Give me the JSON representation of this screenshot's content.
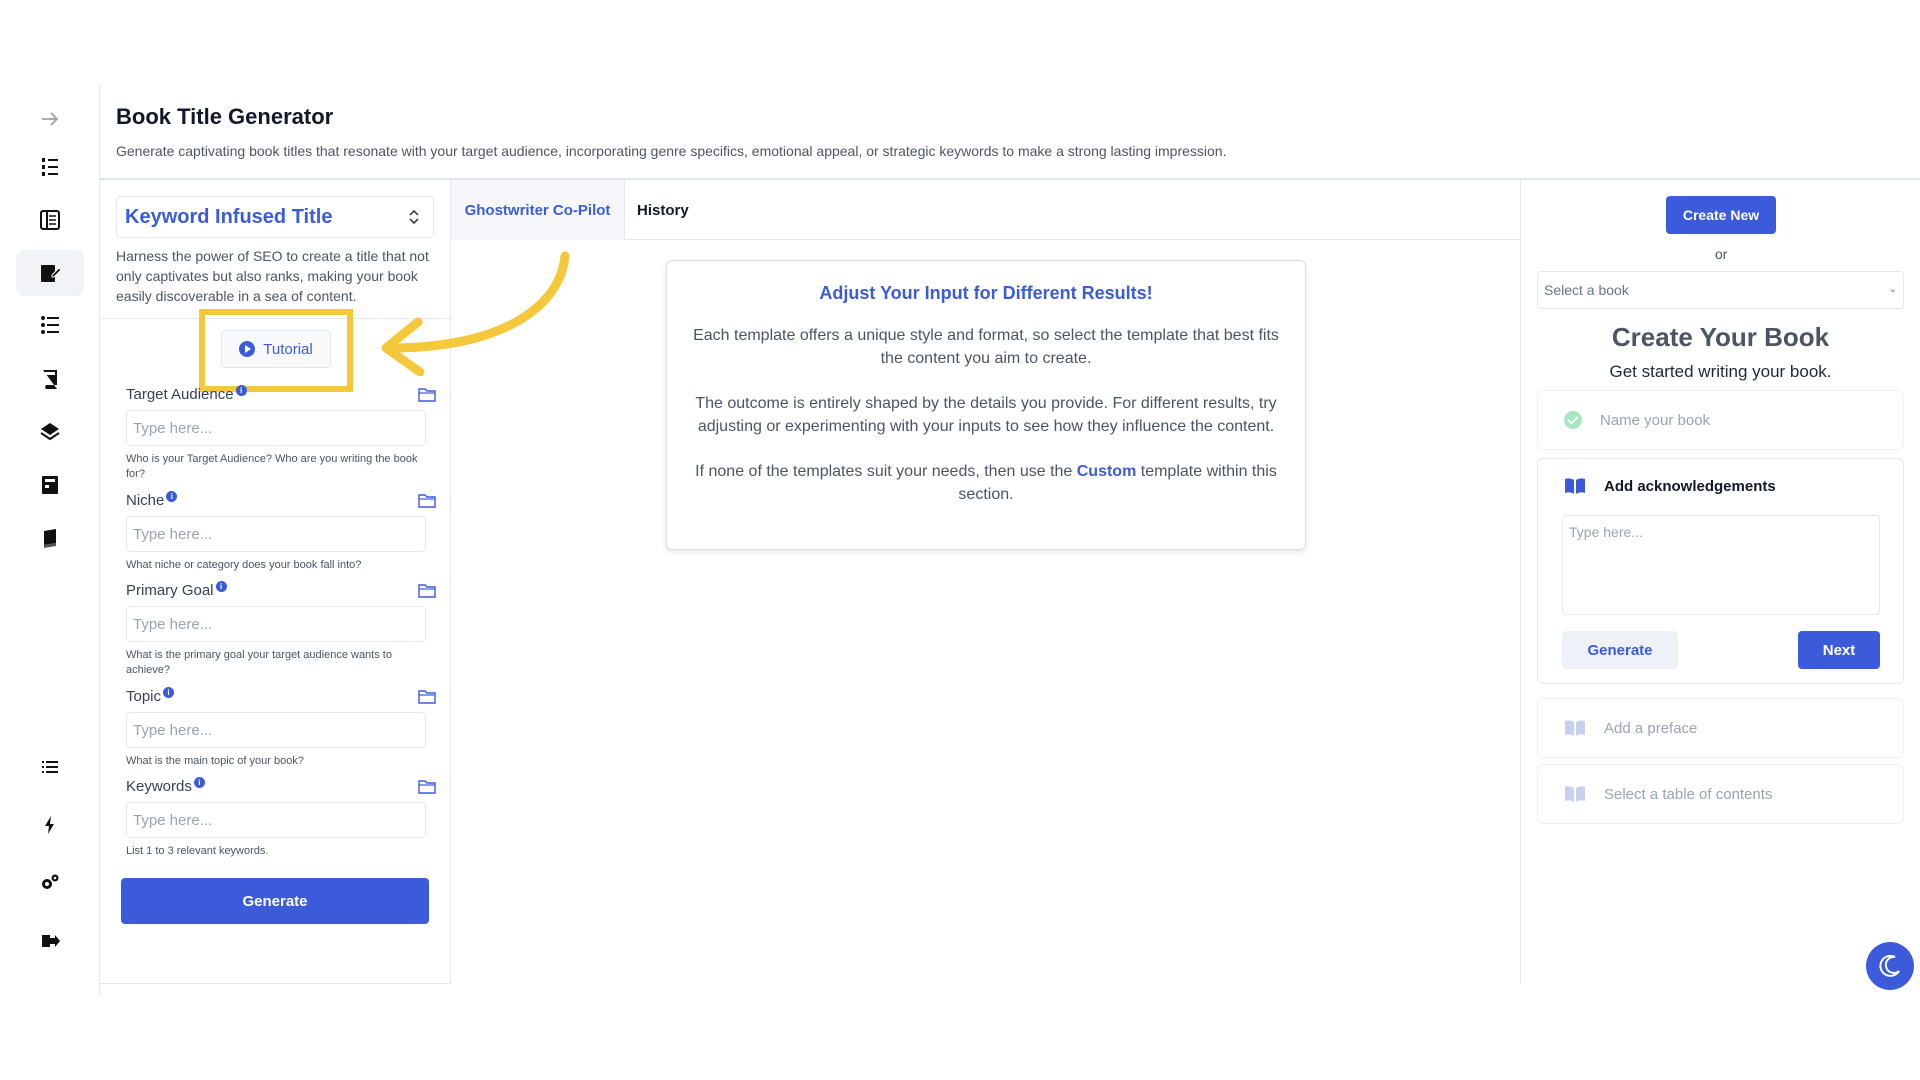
{
  "header": {
    "title": "Book Title Generator",
    "description": "Generate captivating book titles that resonate with your target audience, incorporating genre specifics, emotional appeal, or strategic keywords to make a strong lasting impression."
  },
  "sidebar": {
    "icons": [
      "arrow-right-icon",
      "numbered-list-icon",
      "book-outline-icon",
      "edit-book-icon",
      "list-icon",
      "bookmark-book-icon",
      "tag-book-icon",
      "archive-icon",
      "closed-book-icon",
      "menu-list-icon",
      "lightning-icon",
      "settings-icon",
      "logout-icon"
    ],
    "active": "edit-book-icon"
  },
  "form": {
    "template_name": "Keyword Infused Title",
    "template_description": "Harness the power of SEO to create a title that not only captivates but also ranks, making your book easily discoverable in a sea of content.",
    "tutorial_label": "Tutorial",
    "info_mark": "i",
    "fields": [
      {
        "label": "Target Audience",
        "placeholder": "Type here...",
        "help": "Who is your Target Audience? Who are you writing the book for?"
      },
      {
        "label": "Niche",
        "placeholder": "Type here...",
        "help": "What niche or category does your book fall into?"
      },
      {
        "label": "Primary Goal",
        "placeholder": "Type here...",
        "help": "What is the primary goal your target audience wants to achieve?"
      },
      {
        "label": "Topic",
        "placeholder": "Type here...",
        "help": "What is the main topic of your book?"
      },
      {
        "label": "Keywords",
        "placeholder": "Type here...",
        "help": "List 1 to 3 relevant keywords."
      }
    ],
    "generate_label": "Generate"
  },
  "tabs": {
    "copilot": "Ghostwriter Co-Pilot",
    "history": "History"
  },
  "info_card": {
    "title": "Adjust Your Input for Different Results!",
    "p1": "Each template offers a unique style and format, so select the template that best fits the content you aim to create.",
    "p2": "The outcome is entirely shaped by the details you provide. For different results, try adjusting or experimenting with your inputs to see how they influence the content.",
    "p3_before": "If none of the templates suit your needs, then use the ",
    "p3_link": "Custom",
    "p3_after": " template within this section."
  },
  "right_panel": {
    "create_new": "Create New",
    "or": "or",
    "select_book": "Select a book",
    "title": "Create Your Book",
    "subtitle": "Get started writing your book.",
    "step_name": "Name your book",
    "step_ack": "Add acknowledgements",
    "ack_placeholder": "Type here...",
    "generate_label": "Generate",
    "next_label": "Next",
    "step_preface": "Add a preface",
    "step_toc": "Select a table of contents"
  },
  "colors": {
    "accent": "#3b5bdb",
    "highlight": "#f5c83b"
  }
}
